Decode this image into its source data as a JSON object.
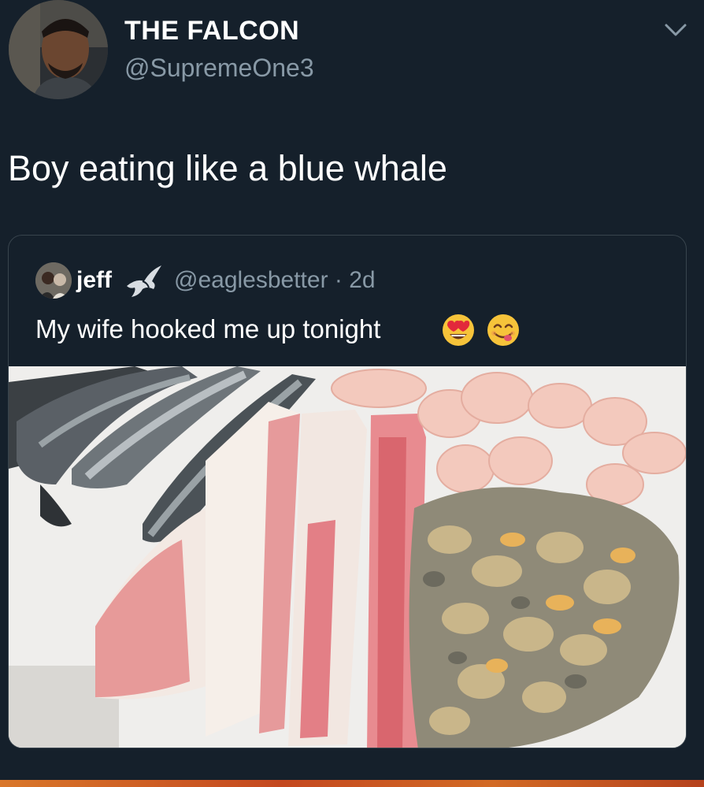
{
  "author": {
    "display_name": "THE FALCON",
    "handle": "@SupremeOne3"
  },
  "tweet": {
    "text": "Boy eating like a blue whale"
  },
  "quoted_tweet": {
    "display_name": "jeff",
    "handle_meta": "@eaglesbetter · 2d",
    "text": "My wife hooked me up tonight",
    "emojis": [
      "heart-eyes-emoji",
      "yum-emoji"
    ],
    "photo": "food-plate-photo"
  },
  "icons": {
    "menu": "chevron-down-icon"
  },
  "colors": {
    "background": "#15202b",
    "secondary_text": "#8899a6",
    "border": "#38444d"
  }
}
